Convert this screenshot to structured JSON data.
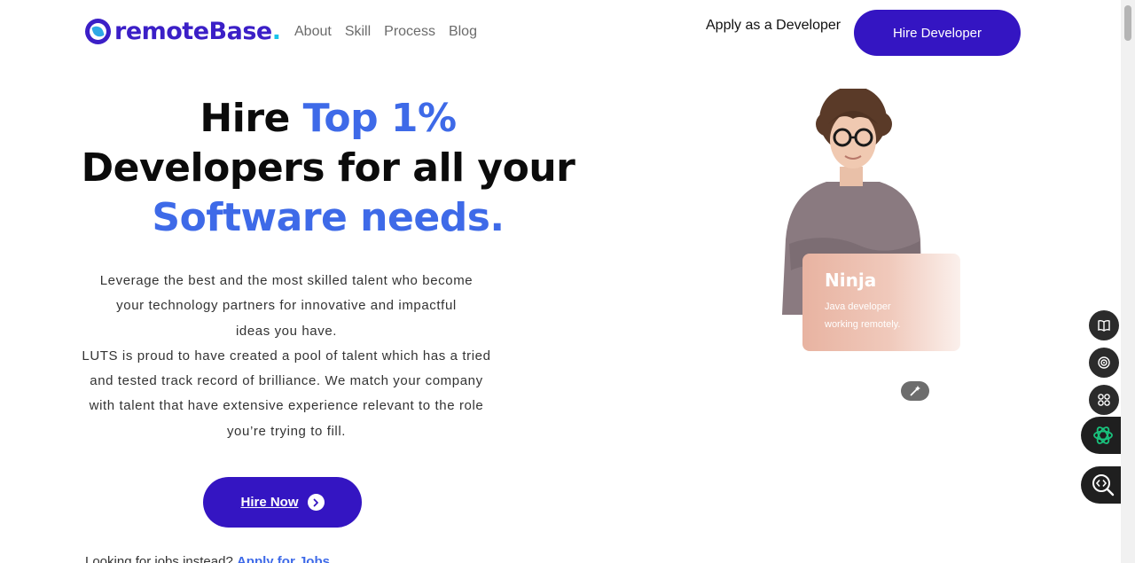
{
  "header": {
    "logo_text": "remoteBase",
    "logo_dot": ".",
    "nav": [
      {
        "label": "About"
      },
      {
        "label": "Skill"
      },
      {
        "label": "Process"
      },
      {
        "label": "Blog"
      }
    ],
    "apply_label": "Apply as a Developer",
    "hire_dev_label": "Hire Developer"
  },
  "hero": {
    "title_hire": "Hire ",
    "title_top": "Top 1%",
    "title_line2": "Developers for all your",
    "title_line3": "Software needs.",
    "desc_p1": "Leverage the best and the most skilled talent who become your technology partners for innovative and impactful ideas you have.",
    "desc_p2": "LUTS is proud to have created a pool of talent which has a tried and tested track record of brilliance. We match your company with talent that have extensive experience relevant to the role you’re trying to fill.",
    "cta_label": "Hire Now",
    "jobs_prefix": "Looking for jobs instead? ",
    "jobs_link": "Apply for Jobs"
  },
  "profile_card": {
    "name": "Ninja",
    "role_line1": "Java developer",
    "role_line2": "working remotely."
  },
  "side_tools": [
    {
      "icon": "book-icon"
    },
    {
      "icon": "broadcast-icon"
    },
    {
      "icon": "apps-grid-icon"
    },
    {
      "icon": "openai-icon"
    },
    {
      "icon": "code-search-icon"
    }
  ],
  "colors": {
    "brand": "#3415c2",
    "accent": "#3e6ae8",
    "logo_dot": "#17c3e8"
  }
}
